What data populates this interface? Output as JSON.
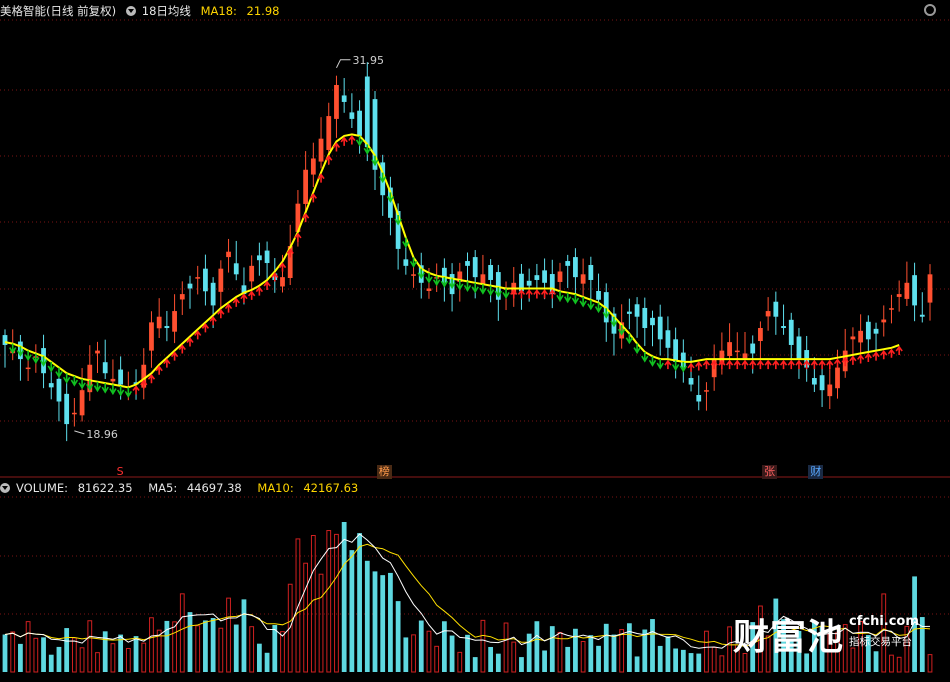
{
  "header": {
    "stock": "美格智能(日线 前复权)",
    "indicator": "18日均线",
    "ma_label": "MA18:",
    "ma_value": "21.98"
  },
  "volume_header": {
    "volume_label": "VOLUME:",
    "volume_value": "81622.35",
    "ma5_label": "MA5:",
    "ma5_value": "44697.38",
    "ma10_label": "MA10:",
    "ma10_value": "42167.63"
  },
  "annotations": {
    "high": "31.95",
    "low": "18.96"
  },
  "markers": [
    {
      "text": "S",
      "color": "#ff3030",
      "bg": "transparent",
      "index": 15
    },
    {
      "text": "榜",
      "color": "#ff9a4a",
      "bg": "#4a2a14",
      "index": 49
    },
    {
      "text": "张",
      "color": "#ff6060",
      "bg": "#3a1a1a",
      "index": 99
    },
    {
      "text": "财",
      "color": "#58a8ff",
      "bg": "#1a2a44",
      "index": 105
    }
  ],
  "watermark": {
    "brand": "财富池",
    "domain": "cfchi.com",
    "sub": "指标交易平台"
  },
  "colors": {
    "up": "#ff5030",
    "down": "#5ee0ee",
    "ma": "#ffff00",
    "ma5": "#ffffff",
    "ma10": "#ffe000",
    "arrow_up": "#ff2020",
    "arrow_down": "#10c020",
    "vol_up": "#d02020",
    "vol_down": "#5ed8e0"
  },
  "chart_data": {
    "type": "candlestick",
    "price_range": [
      18.0,
      33.5
    ],
    "close": [
      22.0,
      21.8,
      21.5,
      21.2,
      21.6,
      21.0,
      20.5,
      20.0,
      19.2,
      19.6,
      20.4,
      21.3,
      21.8,
      21.0,
      20.8,
      20.6,
      20.3,
      20.6,
      21.3,
      22.8,
      23.0,
      22.6,
      23.2,
      23.8,
      24.0,
      24.4,
      23.9,
      23.4,
      24.7,
      25.3,
      24.5,
      23.8,
      24.8,
      25.0,
      24.9,
      24.3,
      24.4,
      25.5,
      27.0,
      28.2,
      28.6,
      29.3,
      30.1,
      31.2,
      30.6,
      30.0,
      29.4,
      29.0,
      28.2,
      27.3,
      26.5,
      25.4,
      24.8,
      24.5,
      24.2,
      24.0,
      24.4,
      24.2,
      23.8,
      24.6,
      24.8,
      24.4,
      24.5,
      24.3,
      23.6,
      24.0,
      24.2,
      23.9,
      24.1,
      24.3,
      24.2,
      23.8,
      24.6,
      24.8,
      24.4,
      24.5,
      24.3,
      23.6,
      22.8,
      22.4,
      22.8,
      23.1,
      23.0,
      22.6,
      22.7,
      22.2,
      21.9,
      21.4,
      21.2,
      20.6,
      20.0,
      20.4,
      21.5,
      21.8,
      22.1,
      21.8,
      21.7,
      21.7,
      22.6,
      23.2,
      23.0,
      22.6,
      22.0,
      21.5,
      21.2,
      20.6,
      20.4,
      20.6,
      21.2,
      21.8,
      22.3,
      22.5,
      22.2,
      22.4,
      22.9,
      23.3,
      23.8,
      24.2,
      23.4,
      23.0,
      24.5
    ],
    "ma18": [
      22.1,
      22.05,
      21.95,
      21.8,
      21.7,
      21.6,
      21.4,
      21.2,
      21.0,
      20.9,
      20.8,
      20.75,
      20.7,
      20.65,
      20.6,
      20.55,
      20.5,
      20.6,
      20.8,
      21.0,
      21.3,
      21.55,
      21.8,
      22.05,
      22.3,
      22.55,
      22.8,
      23.05,
      23.3,
      23.5,
      23.7,
      23.85,
      23.95,
      24.1,
      24.3,
      24.6,
      24.95,
      25.45,
      26.0,
      26.7,
      27.4,
      28.1,
      28.75,
      29.2,
      29.4,
      29.45,
      29.4,
      29.1,
      28.7,
      28.1,
      27.4,
      26.6,
      25.8,
      25.1,
      24.7,
      24.55,
      24.45,
      24.4,
      24.35,
      24.3,
      24.25,
      24.2,
      24.15,
      24.1,
      24.05,
      24.0,
      24.0,
      24.0,
      24.0,
      24.0,
      24.0,
      24.0,
      23.9,
      23.85,
      23.8,
      23.7,
      23.6,
      23.5,
      23.3,
      23.0,
      22.7,
      22.4,
      22.05,
      21.75,
      21.6,
      21.5,
      21.5,
      21.45,
      21.4,
      21.4,
      21.45,
      21.5,
      21.5,
      21.5,
      21.5,
      21.5,
      21.5,
      21.5,
      21.5,
      21.5,
      21.5,
      21.5,
      21.5,
      21.5,
      21.5,
      21.5,
      21.5,
      21.5,
      21.55,
      21.6,
      21.65,
      21.7,
      21.75,
      21.8,
      21.85,
      21.9,
      22.0
    ]
  }
}
